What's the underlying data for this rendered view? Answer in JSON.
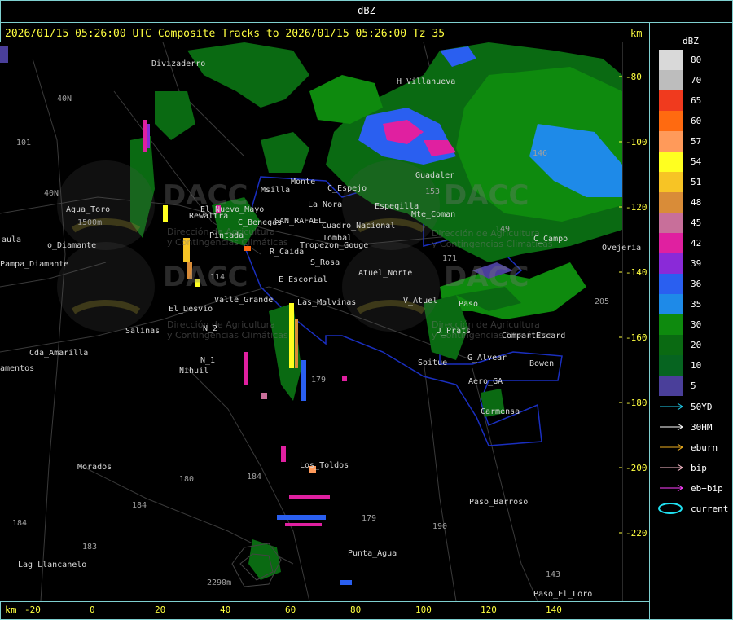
{
  "window": {
    "title": "dBZ"
  },
  "header": {
    "text": "2026/01/15 05:26:00 UTC Composite Tracks to 2026/01/15 05:26:00 Tz 35",
    "km_unit": "km"
  },
  "legend": {
    "title": "dBZ",
    "scale": [
      {
        "value": "80",
        "color": "#d9d9d9"
      },
      {
        "value": "70",
        "color": "#bdbdbd"
      },
      {
        "value": "65",
        "color": "#f03a1e"
      },
      {
        "value": "60",
        "color": "#ff6a10"
      },
      {
        "value": "57",
        "color": "#ff9a5a"
      },
      {
        "value": "54",
        "color": "#ffff20"
      },
      {
        "value": "51",
        "color": "#f7c425"
      },
      {
        "value": "48",
        "color": "#d98c38"
      },
      {
        "value": "45",
        "color": "#c86f9a"
      },
      {
        "value": "42",
        "color": "#e020a0"
      },
      {
        "value": "39",
        "color": "#8a2ad8"
      },
      {
        "value": "36",
        "color": "#2a5ff0"
      },
      {
        "value": "35",
        "color": "#1e8ae8"
      },
      {
        "value": "30",
        "color": "#0e8a0e"
      },
      {
        "value": "20",
        "color": "#0a6a12"
      },
      {
        "value": "10",
        "color": "#066420"
      },
      {
        "value": "5",
        "color": "#4a3f9a"
      }
    ],
    "tracks": [
      {
        "label": "50YD",
        "color": "#20d0f0",
        "icon": "arrow-icon"
      },
      {
        "label": "30HM",
        "color": "#ffffff",
        "icon": "arrow-icon"
      },
      {
        "label": "eburn",
        "color": "#f0b020",
        "icon": "arrow-icon"
      },
      {
        "label": "bip",
        "color": "#ffc0d0",
        "icon": "arrow-icon"
      },
      {
        "label": "eb+bip",
        "color": "#ff40ff",
        "icon": "arrow-icon"
      },
      {
        "label": "current",
        "color": "#20e0f0",
        "icon": "ellipse-icon"
      }
    ]
  },
  "axes": {
    "y_unit": "km",
    "y_ticks": [
      "-80",
      "-100",
      "-120",
      "-140",
      "-160",
      "-180",
      "-200",
      "-220"
    ],
    "x_unit": "km",
    "x_ticks": [
      "-20",
      "0",
      "20",
      "40",
      "60",
      "80",
      "100",
      "120",
      "140"
    ]
  },
  "places": [
    "Divizaderro",
    "H_Villanueva",
    "40N",
    "101",
    "40N",
    "Agua_Toro",
    "1500m",
    "aula",
    "Pampa_Diamante",
    "o_Diamante",
    "Monte",
    "Msilla",
    "C_Espejo",
    "La_Nora",
    "Espeqilla",
    "Guadaler",
    "Rewaltra",
    "El_Nuevo_Mayo",
    "C_Benegas",
    "SAN_RAFAEL",
    "Cuadro_Nacional",
    "Tombal",
    "R_Caida",
    "Tropezon_Gouge",
    "S_Rosa",
    "Atuel_Norte",
    "E_Escorial",
    "Pintada",
    "Valle_Grande",
    "Las_Malvinas",
    "El_Desvio",
    "Salinas",
    "Cda_Amarilla",
    "amentos",
    "N_2",
    "N_1",
    "Nihuil",
    "V_Atuel",
    "J_Prats",
    "G_Alvear",
    "CompartEscard",
    "Bowen",
    "Soitue",
    "Aero_GA",
    "Carmensa",
    "Morados",
    "Los_Toldos",
    "Paso_Barroso",
    "184",
    "143",
    "Paso_El_Loro",
    "Punta_Agua",
    "Lag_Llancanelo",
    "180",
    "184",
    "183",
    "2290m",
    "179",
    "190",
    "146",
    "205",
    "171",
    "149",
    "C_Campo",
    "Ovejeria",
    "Mte_Coman",
    "Paso",
    "114",
    "179",
    "184",
    "153"
  ],
  "branding": {
    "logo_text": "DACC",
    "sub1": "Dirección de Agricultura",
    "sub2": "y Contingencias Climáticas"
  }
}
